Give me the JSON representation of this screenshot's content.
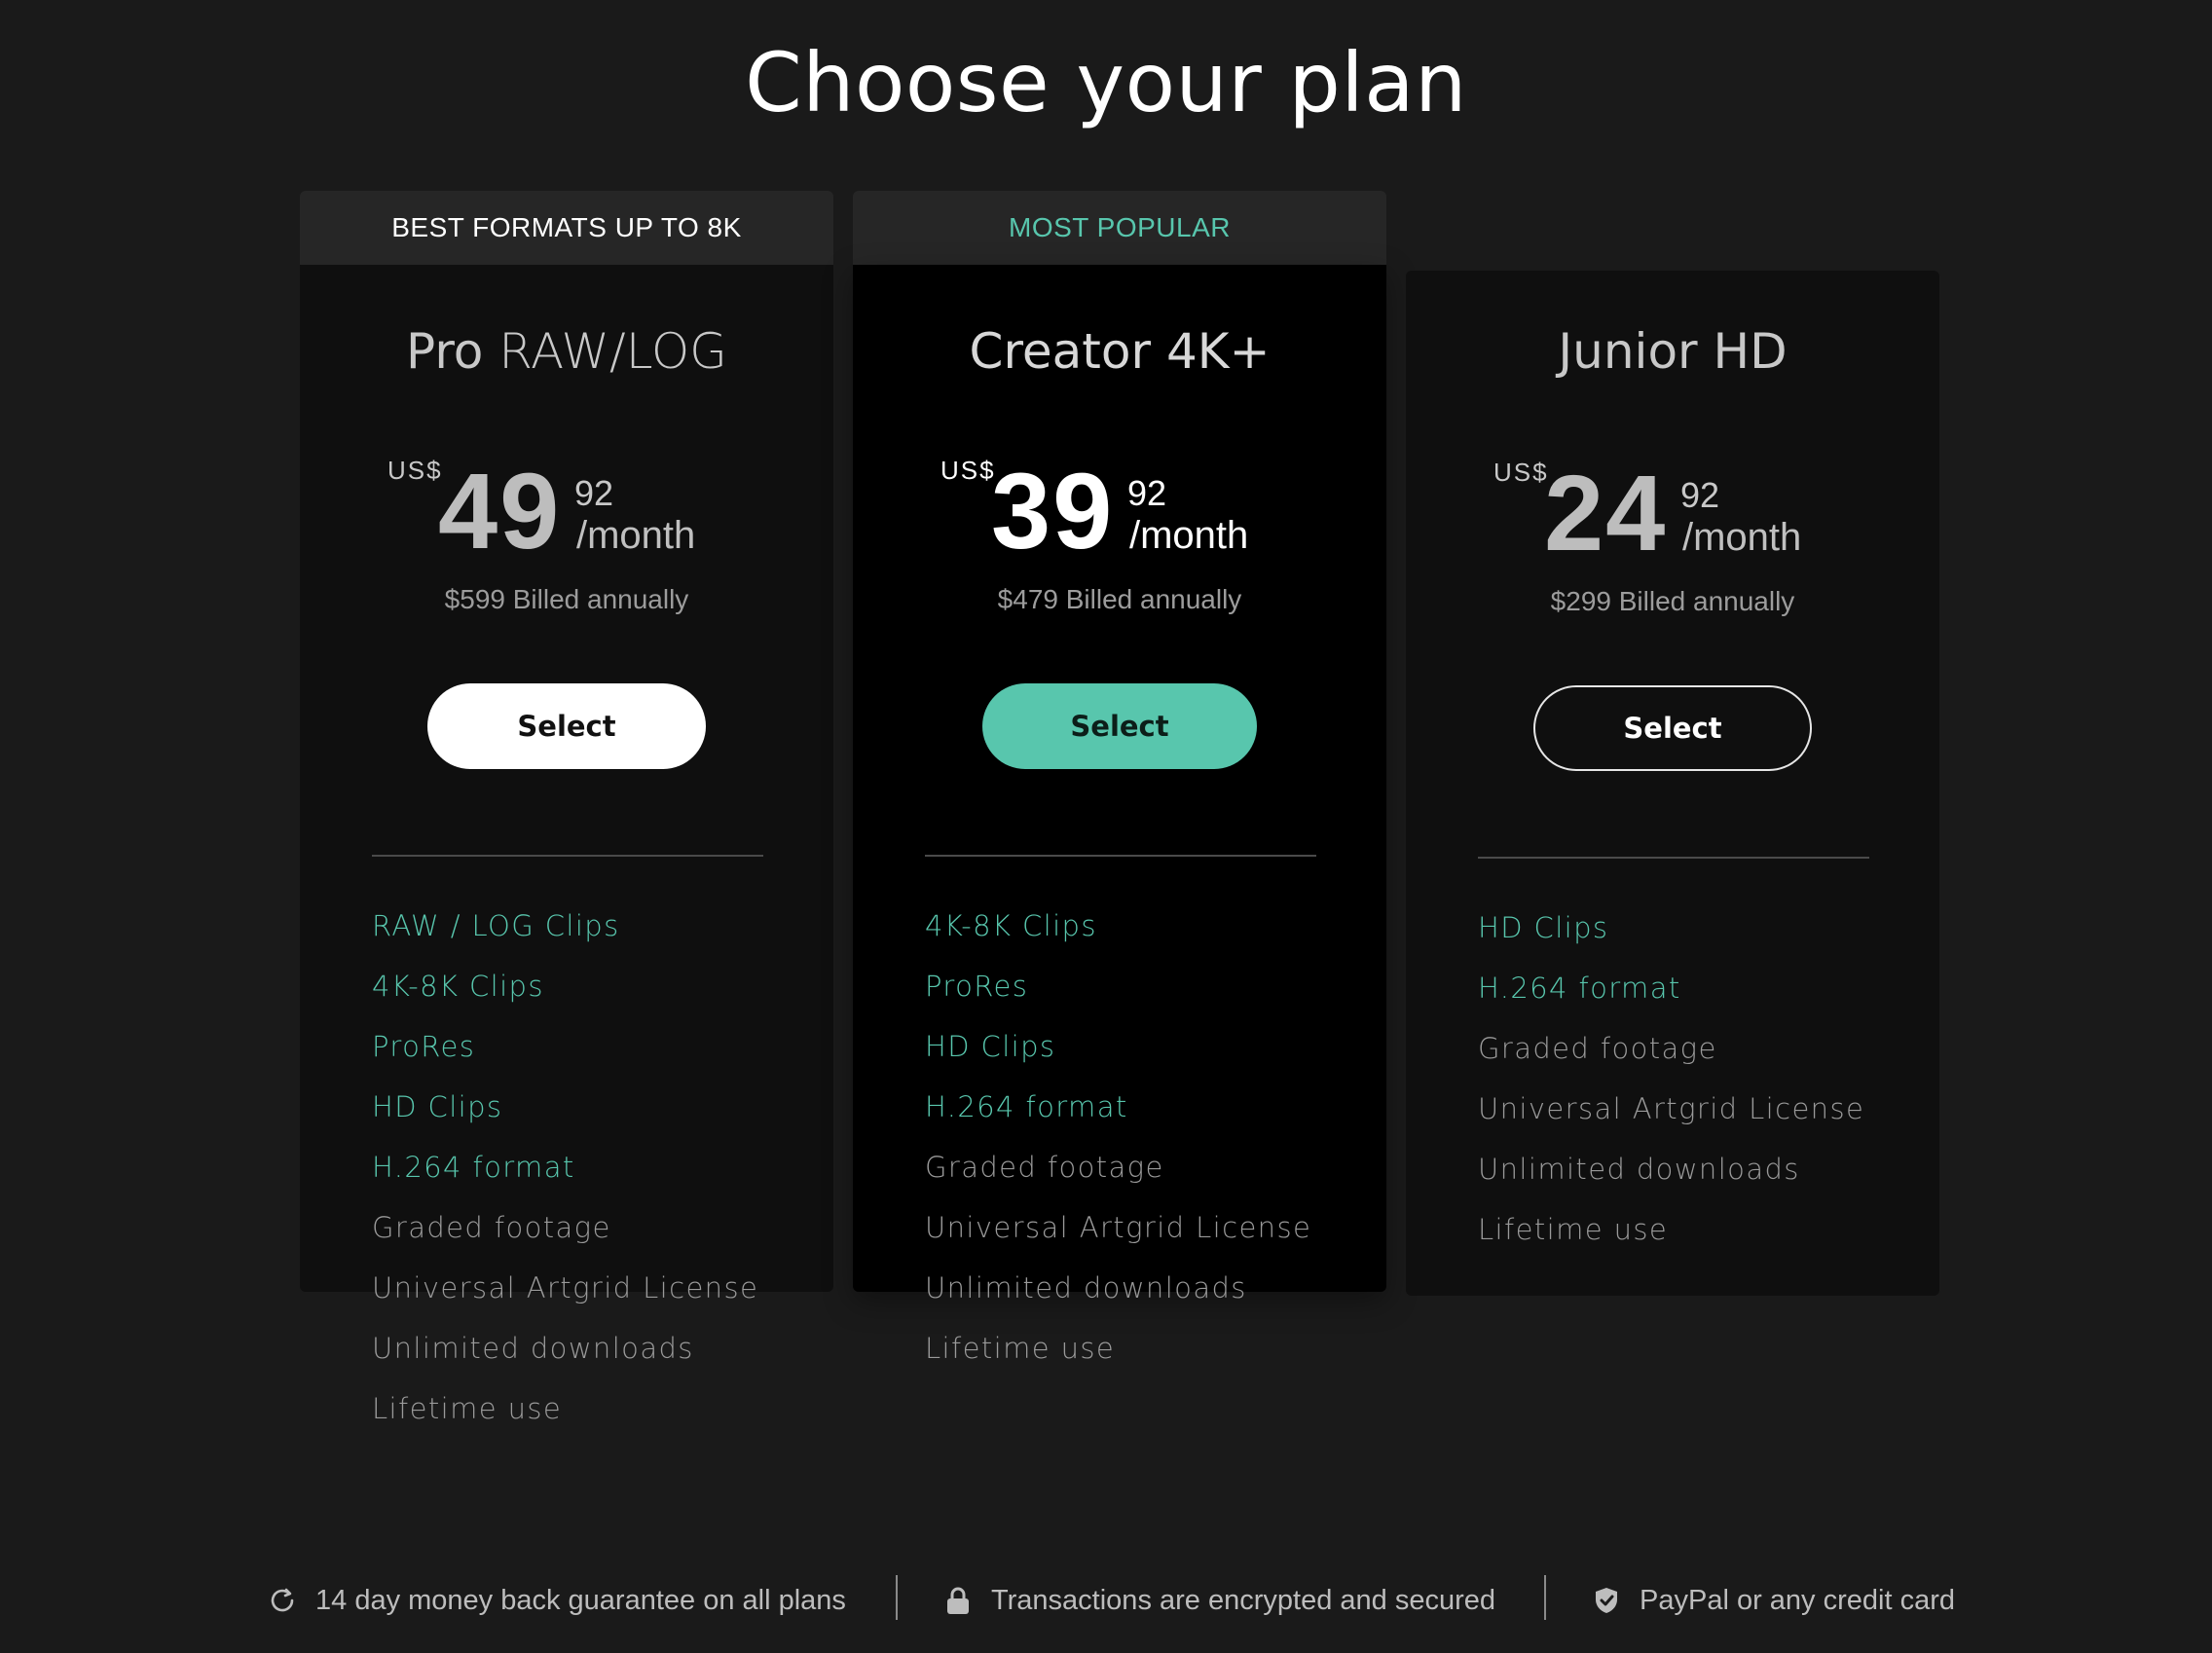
{
  "page": {
    "title": "Choose your plan"
  },
  "plans": [
    {
      "tag": "BEST FORMATS UP TO 8K",
      "name_main": "Pro",
      "name_sub": "RAW/LOG",
      "currency": "US$",
      "amount": "49",
      "cents": "92",
      "period": "/month",
      "billed": "$599 Billed annually",
      "button": "Select",
      "features": [
        "RAW / LOG Clips",
        "4K-8K Clips",
        "ProRes",
        "HD Clips",
        "H.264 format",
        "Graded footage",
        "Universal Artgrid License",
        "Unlimited downloads",
        "Lifetime use"
      ],
      "highlighted_count": 5
    },
    {
      "tag": "MOST POPULAR",
      "name_main": "Creator",
      "name_sub": "4K+",
      "currency": "US$",
      "amount": "39",
      "cents": "92",
      "period": "/month",
      "billed": "$479 Billed annually",
      "button": "Select",
      "features": [
        "4K-8K Clips",
        "ProRes",
        "HD Clips",
        "H.264 format",
        "Graded footage",
        "Universal Artgrid License",
        "Unlimited downloads",
        "Lifetime use"
      ],
      "highlighted_count": 4
    },
    {
      "tag": "",
      "name_main": "Junior HD",
      "name_sub": "",
      "currency": "US$",
      "amount": "24",
      "cents": "92",
      "period": "/month",
      "billed": "$299 Billed annually",
      "button": "Select",
      "features": [
        "HD Clips",
        "H.264 format",
        "Graded footage",
        "Universal Artgrid License",
        "Unlimited downloads",
        "Lifetime use"
      ],
      "highlighted_count": 2
    }
  ],
  "footer": {
    "guarantee": {
      "icon": "refresh-icon",
      "text": "14 day money back guarantee on all plans"
    },
    "security": {
      "icon": "lock-icon",
      "text": "Transactions are encrypted and secured"
    },
    "payment": {
      "icon": "shield-check-icon",
      "text": "PayPal or any credit card"
    }
  },
  "colors": {
    "background": "#1a1a1a",
    "card": "#0f0f0f",
    "card_popular": "#000000",
    "accent": "#58c6ad",
    "tag_bg": "#262626"
  }
}
